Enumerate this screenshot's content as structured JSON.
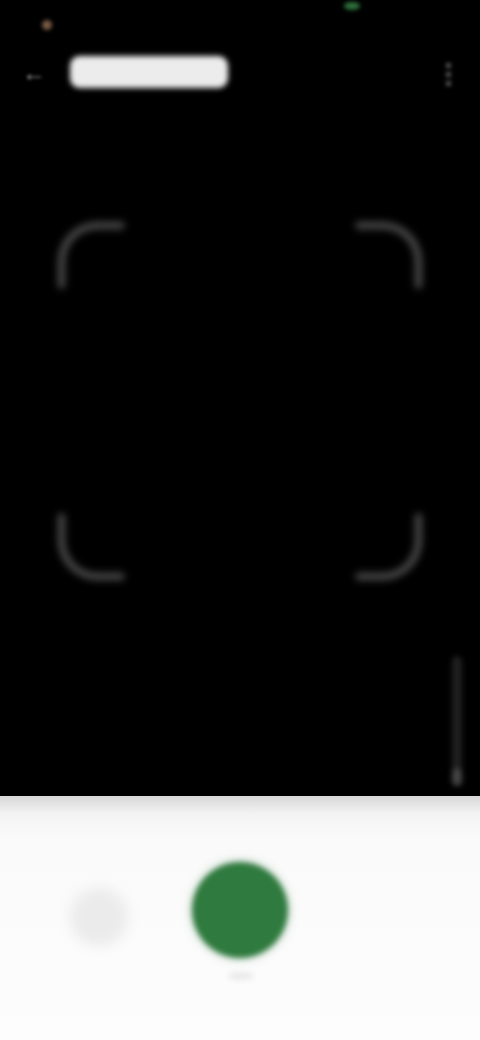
{
  "colors": {
    "background": "#000000",
    "capture_accent": "#2f7a3e",
    "status_dot_left": "#7a5b45",
    "status_dot_center": "#2e6e3a",
    "panel": "#fdfdfd"
  },
  "top_bar": {
    "back_icon": "arrow-left-icon",
    "title": "",
    "overflow_icon": "more-vert-icon"
  },
  "scanner": {
    "hint": ""
  },
  "zoom": {
    "level": 0.0
  },
  "bottom_panel": {
    "gallery_icon": "image-icon",
    "capture_icon": "shutter-icon"
  }
}
